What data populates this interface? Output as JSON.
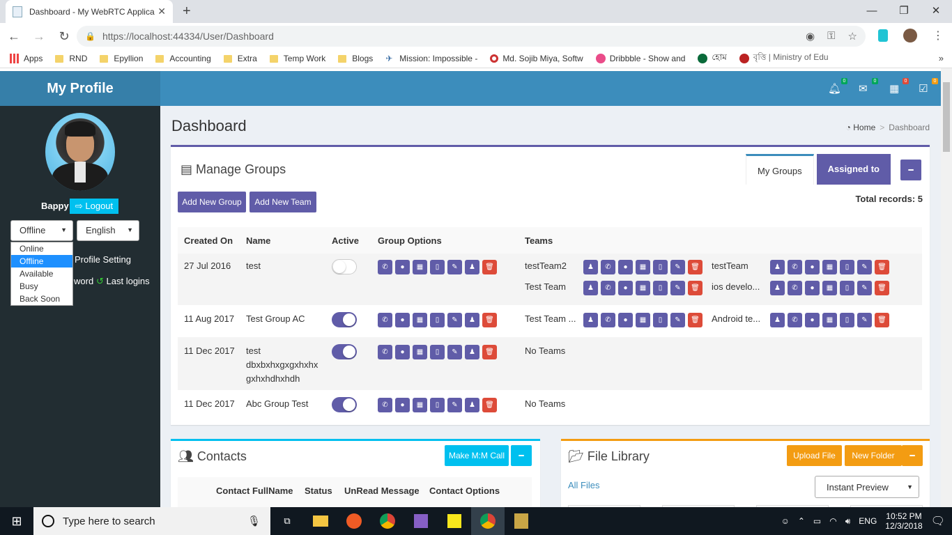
{
  "browser": {
    "tab_title": "Dashboard - My WebRTC Applica",
    "url_host": "https://localhost",
    "url_rest": ":44334/User/Dashboard"
  },
  "bookmarks": [
    "Apps",
    "RND",
    "Epyllion",
    "Accounting",
    "Extra",
    "Temp Work",
    "Blogs",
    "Mission: Impossible -",
    "Md. Sojib Miya, Softw",
    "Dribbble - Show and",
    "হোম",
    "বৃত্তি | Ministry of Edu"
  ],
  "brand": "My Profile",
  "badges": [
    "0",
    "0",
    "0",
    "0"
  ],
  "user": {
    "name": "Bappy",
    "logout": "Logout"
  },
  "status": {
    "selected": "Offline",
    "options": [
      "Online",
      "Offline",
      "Available",
      "Busy",
      "Back Soon"
    ]
  },
  "language": {
    "selected": "English"
  },
  "sidebar": {
    "profile_setting": "Profile Setting",
    "password": "word",
    "last_logins": "Last logins"
  },
  "page": {
    "title": "Dashboard",
    "bc_home": "Home",
    "bc_current": "Dashboard"
  },
  "groups": {
    "title": "Manage Groups",
    "tab_my": "My Groups",
    "tab_assigned": "Assigned to",
    "add_group": "Add New Group",
    "add_team": "Add New Team",
    "total": "Total records: 5",
    "headers": [
      "Created On",
      "Name",
      "Active",
      "Group Options",
      "Teams"
    ],
    "rows": [
      {
        "date": "27 Jul 2016",
        "name": "test",
        "active": false,
        "teams": [
          [
            "testTeam2",
            "testTeam"
          ],
          [
            "Test Team",
            "ios develo..."
          ]
        ]
      },
      {
        "date": "11 Aug 2017",
        "name": "Test Group AC",
        "active": true,
        "teams": [
          [
            "Test Team ...",
            "Android te..."
          ]
        ]
      },
      {
        "date": "11 Dec 2017",
        "name": "test dbxbxhxgxgxhxhxgxhxhdhxhdh",
        "name_l1": "test",
        "name_l2": "dbxbxhxgxgxhxhx",
        "name_l3": "gxhxhdhxhdh",
        "active": true,
        "no_teams": "No Teams"
      },
      {
        "date": "11 Dec 2017",
        "name": "Abc Group Test",
        "active": true,
        "no_teams": "No Teams"
      }
    ]
  },
  "contacts": {
    "title": "Contacts",
    "call": "Make M:M Call",
    "headers": [
      "Contact FullName",
      "Status",
      "UnRead Message",
      "Contact Options"
    ]
  },
  "files": {
    "title": "File Library",
    "upload": "Upload File",
    "folder": "New Folder",
    "all": "All Files",
    "preview": "Instant Preview"
  },
  "taskbar": {
    "search": "Type here to search",
    "lang": "ENG",
    "time": "10:52 PM",
    "date": "12/3/2018"
  },
  "colors": {
    "purple": "#605ca8",
    "cyan": "#00c0ef",
    "orange": "#f39c12",
    "red": "#dd4b39",
    "header": "#3c8dbc",
    "sidebar": "#222d32"
  }
}
